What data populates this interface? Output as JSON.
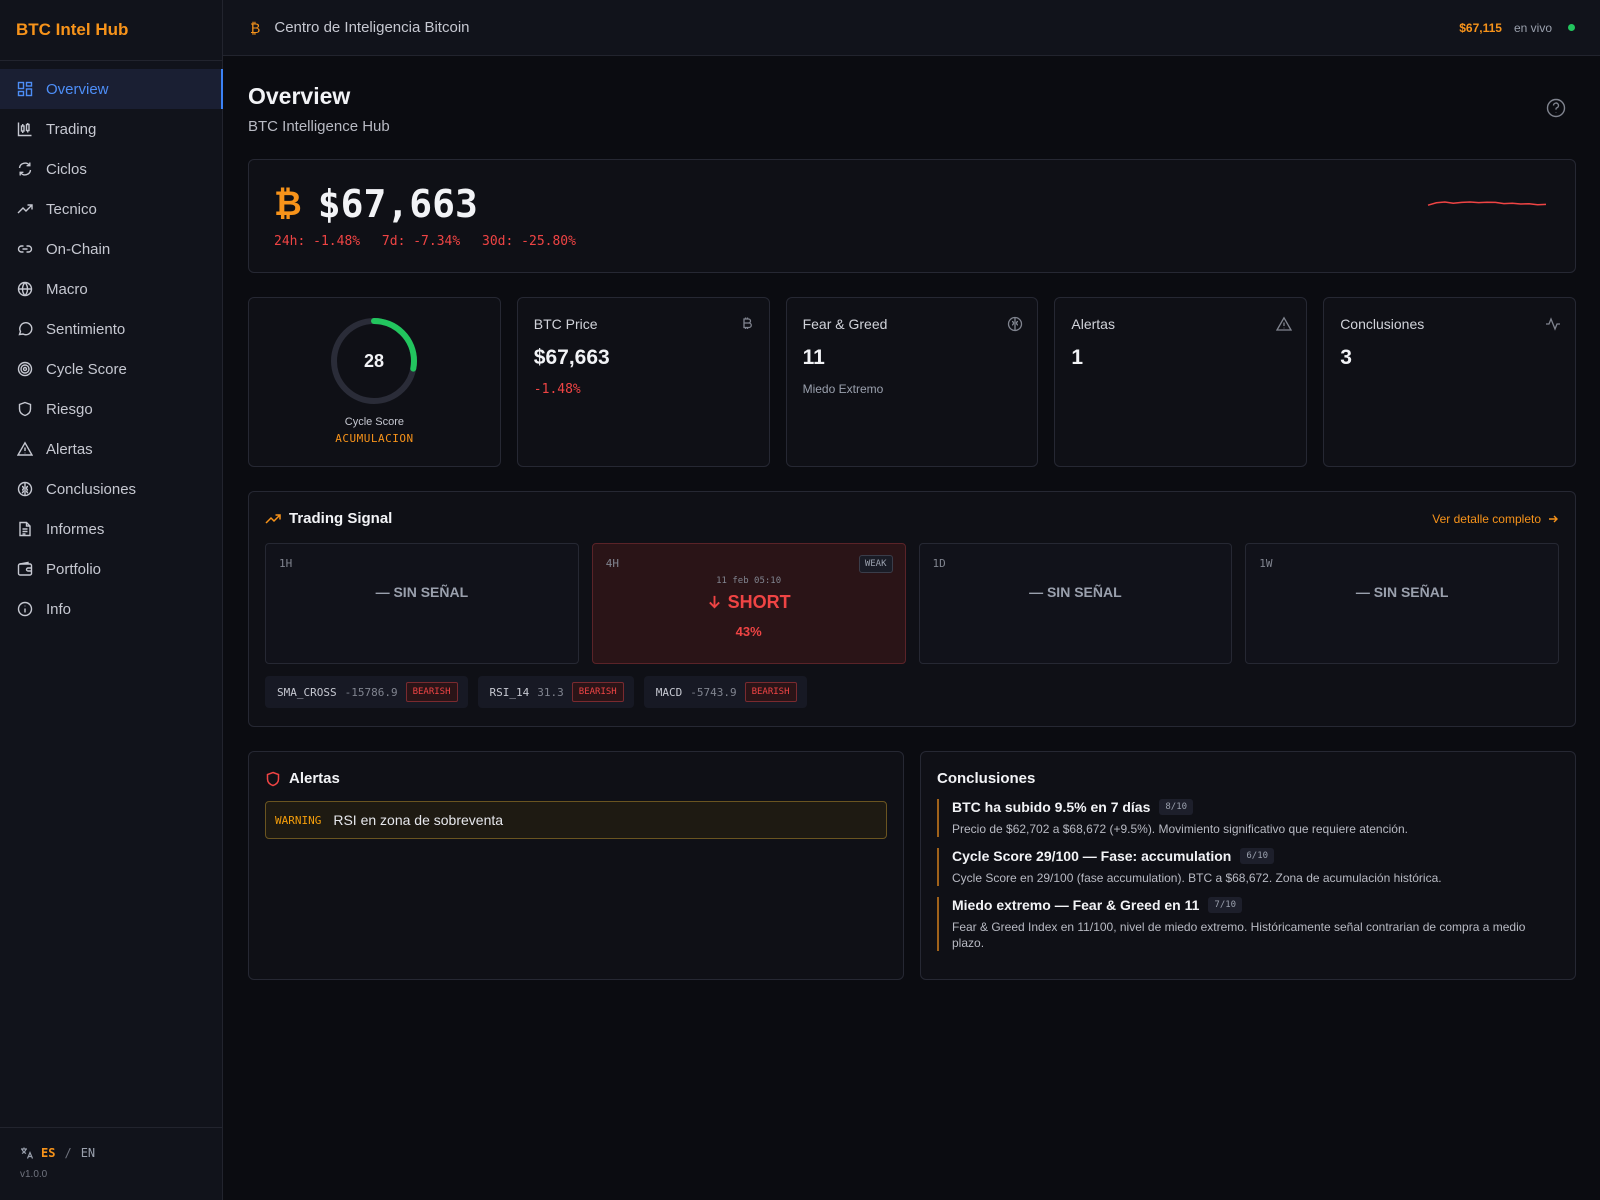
{
  "app": {
    "brand": "BTC Intel Hub",
    "version": "v1.0.0",
    "lang_active": "ES",
    "lang_sep": "/",
    "lang_other": "EN"
  },
  "sidebar": {
    "items": [
      {
        "label": "Overview",
        "icon": "grid-icon",
        "active": true
      },
      {
        "label": "Trading",
        "icon": "candlestick-icon"
      },
      {
        "label": "Ciclos",
        "icon": "refresh-icon"
      },
      {
        "label": "Tecnico",
        "icon": "trending-up-icon"
      },
      {
        "label": "On-Chain",
        "icon": "link-icon"
      },
      {
        "label": "Macro",
        "icon": "globe-icon"
      },
      {
        "label": "Sentimiento",
        "icon": "message-icon"
      },
      {
        "label": "Cycle Score",
        "icon": "target-icon"
      },
      {
        "label": "Riesgo",
        "icon": "shield-icon"
      },
      {
        "label": "Alertas",
        "icon": "warning-icon"
      },
      {
        "label": "Conclusiones",
        "icon": "brain-icon"
      },
      {
        "label": "Informes",
        "icon": "document-icon"
      },
      {
        "label": "Portfolio",
        "icon": "wallet-icon"
      },
      {
        "label": "Info",
        "icon": "info-icon"
      }
    ]
  },
  "header": {
    "glyph": "₿",
    "title": "Centro de Inteligencia Bitcoin",
    "price": "$67,115",
    "live": "en vivo",
    "live_color": "#22c55e"
  },
  "page": {
    "title": "Overview",
    "subtitle": "BTC Intelligence Hub"
  },
  "hero": {
    "glyph": "₿",
    "price": "$67,663",
    "change_24h": "24h: -1.48%",
    "change_7d": "7d: -7.34%",
    "change_30d": "30d: -25.80%",
    "sparkline": [
      0.2,
      0.8,
      1.0,
      0.7,
      0.9,
      1.0,
      0.85,
      0.95,
      0.9,
      0.6,
      0.7,
      0.5,
      0.55,
      0.3,
      0.4
    ]
  },
  "stats": {
    "cycle": {
      "score": "28",
      "score_fraction": 0.28,
      "label": "Cycle Score",
      "phase": "ACUMULACION",
      "color": "#22c55e"
    },
    "price": {
      "label": "BTC Price",
      "value": "$67,663",
      "change": "-1.48%"
    },
    "fear": {
      "label": "Fear & Greed",
      "value": "11",
      "sub": "Miedo Extremo"
    },
    "alerts": {
      "label": "Alertas",
      "value": "1"
    },
    "conclusions": {
      "label": "Conclusiones",
      "value": "3"
    }
  },
  "signal": {
    "title": "Trading Signal",
    "link": "Ver detalle completo",
    "timeframes": [
      {
        "name": "1H",
        "text": "— SIN SEÑAL"
      },
      {
        "name": "4H",
        "badge": "WEAK",
        "timestamp": "11 feb 05:10",
        "direction": "SHORT",
        "confidence": "43%"
      },
      {
        "name": "1D",
        "text": "— SIN SEÑAL"
      },
      {
        "name": "1W",
        "text": "— SIN SEÑAL"
      }
    ],
    "indicators": [
      {
        "name": "SMA_CROSS",
        "value": "-15786.9",
        "tag": "BEARISH"
      },
      {
        "name": "RSI_14",
        "value": "31.3",
        "tag": "BEARISH"
      },
      {
        "name": "MACD",
        "value": "-5743.9",
        "tag": "BEARISH"
      }
    ]
  },
  "alerts": {
    "title": "Alertas",
    "items": [
      {
        "level": "WARNING",
        "message": "RSI en zona de sobreventa"
      }
    ]
  },
  "conclusions": {
    "title": "Conclusiones",
    "items": [
      {
        "title": "BTC ha subido 9.5% en 7 días",
        "score": "8/10",
        "desc": "Precio de $62,702 a $68,672 (+9.5%). Movimiento significativo que requiere atención."
      },
      {
        "title": "Cycle Score 29/100 — Fase: accumulation",
        "score": "6/10",
        "desc": "Cycle Score en 29/100 (fase accumulation). BTC a $68,672. Zona de acumulación histórica."
      },
      {
        "title": "Miedo extremo — Fear & Greed en 11",
        "score": "7/10",
        "desc": "Fear & Greed Index en 11/100, nivel de miedo extremo. Históricamente señal contrarian de compra a medio plazo."
      }
    ]
  }
}
